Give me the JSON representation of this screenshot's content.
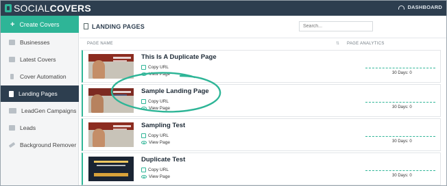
{
  "brand": {
    "name_light": "SOCIAL",
    "name_bold": "COVERS"
  },
  "topbar": {
    "dashboard_label": "DASHBOARD"
  },
  "sidebar": {
    "create_label": "Create Covers",
    "items": [
      {
        "label": "Businesses",
        "icon": "briefcase-icon"
      },
      {
        "label": "Latest Covers",
        "icon": "image-icon"
      },
      {
        "label": "Cover Automation",
        "icon": "bolt-icon"
      },
      {
        "label": "Landing Pages",
        "icon": "document-icon",
        "active": true
      },
      {
        "label": "LeadGen Campaigns",
        "icon": "megaphone-icon"
      },
      {
        "label": "Leads",
        "icon": "users-icon"
      },
      {
        "label": "Background Remover",
        "icon": "magic-wand-icon"
      }
    ]
  },
  "page": {
    "title": "LANDING PAGES",
    "search_placeholder": "Search..."
  },
  "table": {
    "col_name": "PAGE NAME",
    "col_analytics": "PAGE ANALYTICS",
    "rows": [
      {
        "name": "This Is A Duplicate Page",
        "copy_url": "Copy URL",
        "view_page": "View Page",
        "analytics": "30 Days: 0"
      },
      {
        "name": "Sample Landing Page",
        "copy_url": "Copy URL",
        "view_page": "View Page",
        "analytics": "30 Days: 0"
      },
      {
        "name": "Sampling Test",
        "copy_url": "Copy URL",
        "view_page": "View Page",
        "analytics": "30 Days: 0"
      },
      {
        "name": "Duplicate Test",
        "copy_url": "Copy URL",
        "view_page": "View Page",
        "analytics": "30 Days: 0"
      }
    ]
  },
  "colors": {
    "accent": "#2eb597",
    "topbar": "#2d3e4f",
    "sidebar_bg": "#f4f5f6"
  }
}
